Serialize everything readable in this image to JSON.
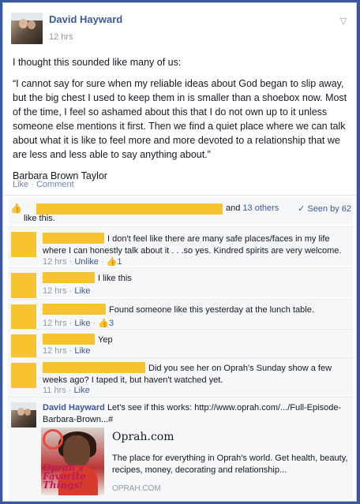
{
  "post": {
    "author": "David Hayward",
    "time": "12 hrs",
    "intro": "I thought this sounded like many of us:",
    "quote": "“I cannot say for sure when my reliable ideas about God began to slip away, but the big chest I used to keep them in is smaller than a shoebox now. Most of the time, I feel so ashamed about this that I do not own up to it unless someone else mentions it first. Then we find a quiet place where we can talk about what it is like to feel more and more devoted to a relationship that we are less and less able to say anything about.”",
    "attribution": "Barbara Brown Taylor",
    "like_label": "Like",
    "comment_label": "Comment"
  },
  "likes": {
    "and_text": "and",
    "others": "13 others",
    "seen": "Seen by 62",
    "like_this": "like this."
  },
  "comments": [
    {
      "text": "I don't feel like there are many safe places/faces in my life where I can honestly talk about it . . .so yes. Kindred spirits are very welcome.",
      "time": "12 hrs",
      "action": "Unlike",
      "likes": "1"
    },
    {
      "text": "I like this",
      "time": "12 hrs",
      "action": "Like"
    },
    {
      "text": "Found someone like this yesterday at the lunch table.",
      "time": "12 hrs",
      "action": "Like",
      "likes": "3"
    },
    {
      "text": "Yep",
      "time": "12 hrs",
      "action": "Like"
    },
    {
      "text": "Did you see her on Oprah's Sunday show a few weeks ago? I taped it, but haven't watched yet.",
      "time": "11 hrs",
      "action": "Like"
    }
  ],
  "reply": {
    "author": "David Hayward",
    "text": "Let's see if this works: http://www.oprah.com/.../Full-Episode-Barbara-Brown...#"
  },
  "link_card": {
    "title": "Oprah.com",
    "description": "The place for everything in Oprah's world. Get health, beauty, recipes, money, decorating and relationship...",
    "domain": "OPRAH.COM",
    "cover_text": "Oprah's Favorite Things!"
  }
}
